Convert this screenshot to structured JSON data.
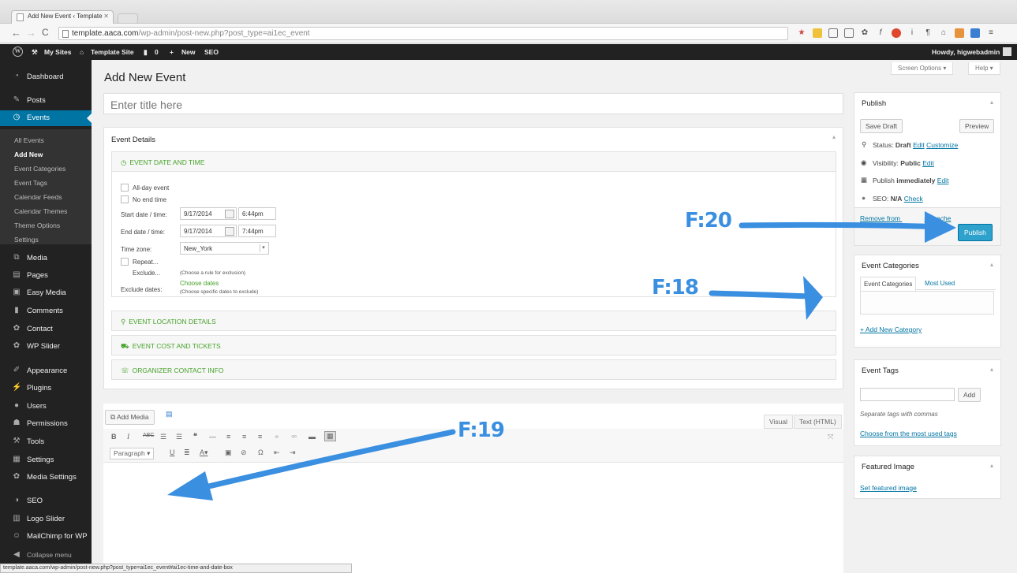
{
  "browser": {
    "tab_title": "Add New Event ‹ Template",
    "url_host": "template.aaca.com",
    "url_path": "/wp-admin/post-new.php?post_type=ai1ec_event",
    "status_url": "template.aaca.com/wp-admin/post-new.php?post_type=ai1ec_event#ai1ec-time-and-date-box"
  },
  "adminbar": {
    "my_sites": "My Sites",
    "site_name": "Template Site",
    "comments_count": "0",
    "new_label": "New",
    "seo_label": "SEO",
    "howdy": "Howdy, higwebadmin"
  },
  "sidebar": {
    "items": [
      {
        "label": "Dashboard",
        "icon": "gauge-icon"
      },
      {
        "label": "Posts",
        "icon": "pushpin-icon"
      },
      {
        "label": "Events",
        "icon": "clock-icon"
      },
      {
        "label": "Media",
        "icon": "media-icon"
      },
      {
        "label": "Pages",
        "icon": "page-icon"
      },
      {
        "label": "Easy Media",
        "icon": "easy-media-icon"
      },
      {
        "label": "Comments",
        "icon": "comment-icon"
      },
      {
        "label": "Contact",
        "icon": "gear-icon"
      },
      {
        "label": "WP Slider",
        "icon": "gear-icon"
      },
      {
        "label": "Appearance",
        "icon": "brush-icon"
      },
      {
        "label": "Plugins",
        "icon": "plug-icon"
      },
      {
        "label": "Users",
        "icon": "user-icon"
      },
      {
        "label": "Permissions",
        "icon": "users-icon"
      },
      {
        "label": "Tools",
        "icon": "wrench-icon"
      },
      {
        "label": "Settings",
        "icon": "settings-icon"
      },
      {
        "label": "Media Settings",
        "icon": "gear-icon"
      },
      {
        "label": "SEO",
        "icon": "seo-icon"
      },
      {
        "label": "Logo Slider",
        "icon": "slider-icon"
      },
      {
        "label": "MailChimp for WP",
        "icon": "mailchimp-icon"
      },
      {
        "label": "Collapse menu",
        "icon": "collapse-icon"
      }
    ],
    "submenu": [
      "All Events",
      "Add New",
      "Event Categories",
      "Event Tags",
      "Calendar Feeds",
      "Calendar Themes",
      "Theme Options",
      "Settings"
    ]
  },
  "main": {
    "page_title": "Add New Event",
    "screen_options": "Screen Options",
    "help": "Help",
    "title_placeholder": "Enter title here",
    "event_details": {
      "title": "Event Details",
      "date_section": "EVENT DATE AND TIME",
      "all_day": "All-day event",
      "no_end_time": "No end time",
      "start_label": "Start date / time:",
      "start_date": "9/17/2014",
      "start_time": "6:44pm",
      "end_label": "End date / time:",
      "end_date": "9/17/2014",
      "end_time": "7:44pm",
      "timezone_label": "Time zone:",
      "timezone": "New_York",
      "repeat": "Repeat...",
      "exclude": "Exclude...",
      "exclude_hint": "(Choose a rule for exclusion)",
      "exclude_dates_label": "Exclude dates:",
      "choose_dates": "Choose dates",
      "choose_dates_hint": "(Choose specific dates to exclude)",
      "location_section": "EVENT LOCATION DETAILS",
      "cost_section": "EVENT COST AND TICKETS",
      "organizer_section": "ORGANIZER CONTACT INFO"
    },
    "editor": {
      "add_media": "Add Media",
      "visual_tab": "Visual",
      "text_tab": "Text (HTML)",
      "format": "Paragraph"
    }
  },
  "right": {
    "publish": {
      "title": "Publish",
      "save_draft": "Save Draft",
      "preview": "Preview",
      "status_label": "Status:",
      "status_value": "Draft",
      "edit": "Edit",
      "customize": "Customize",
      "visibility_label": "Visibility:",
      "visibility_value": "Public",
      "publish_label": "Publish",
      "publish_value": "immediately",
      "seo_label": "SEO:",
      "seo_value": "N/A",
      "check": "Check",
      "remove_cache": "Remove from ",
      "remove_cache_tail": "ce cache",
      "publish_button": "Publish"
    },
    "categories": {
      "title": "Event Categories",
      "tab_all": "Event Categories",
      "tab_used": "Most Used",
      "add_new": "+ Add New Category"
    },
    "tags": {
      "title": "Event Tags",
      "add": "Add",
      "hint": "Separate tags with commas",
      "choose": "Choose from the most used tags"
    },
    "featured": {
      "title": "Featured Image",
      "set": "Set featured image"
    }
  },
  "annotations": {
    "f20": "F:20",
    "f18": "F:18",
    "f19": "F:19",
    "color": "#3a8fe0"
  }
}
